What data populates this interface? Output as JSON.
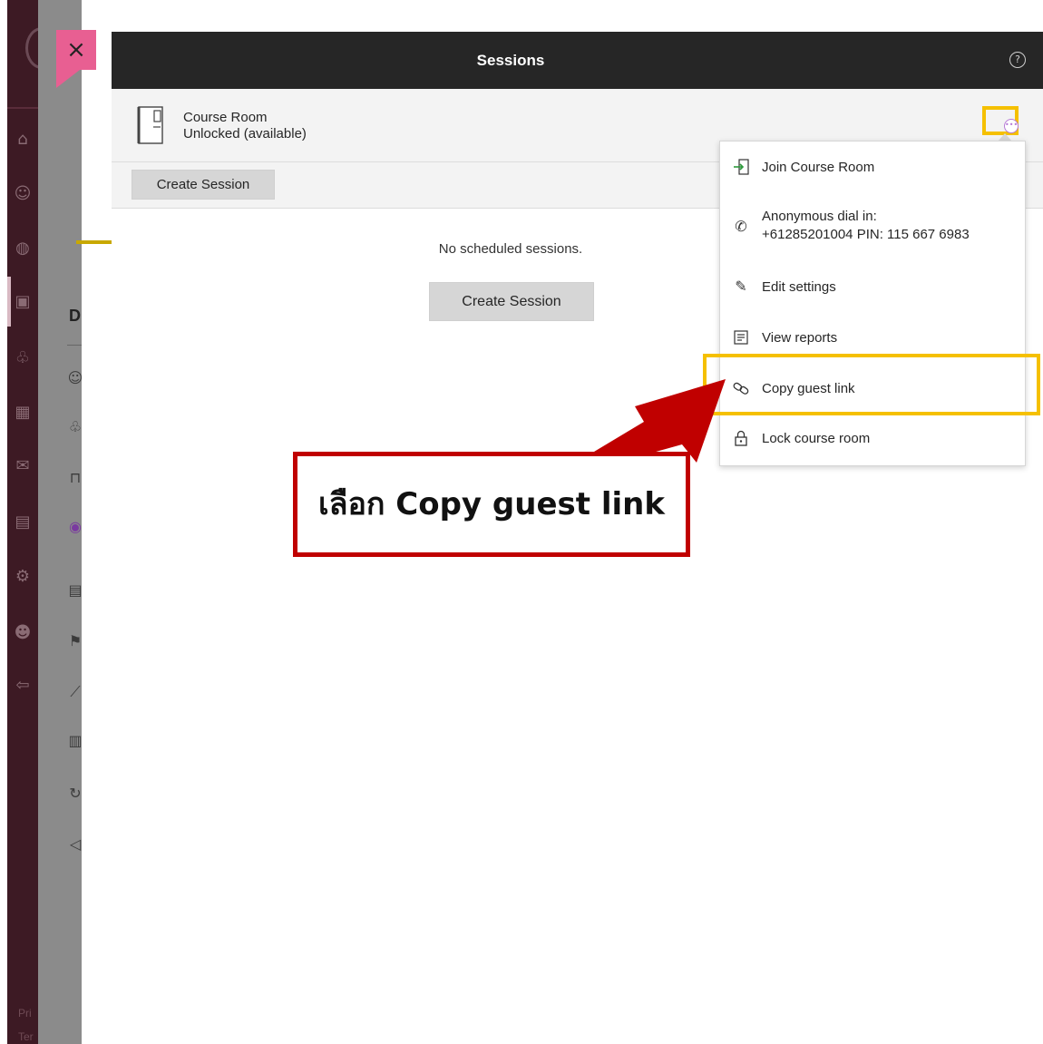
{
  "header": {
    "title": "Sessions",
    "help_icon": "help-circle-icon"
  },
  "close_label": "×",
  "course_room": {
    "name": "Course Room",
    "status": "Unlocked (available)",
    "icon": "door-icon",
    "more_icon": "more-options-icon"
  },
  "toolbar": {
    "create_label": "Create Session"
  },
  "main": {
    "empty_message": "No scheduled sessions.",
    "create_label": "Create Session"
  },
  "menu": {
    "items": [
      {
        "label": "Join Course Room",
        "icon": "enter-icon"
      },
      {
        "label": "Anonymous dial in:",
        "sub": "+61285201004 PIN: 115 667 6983",
        "icon": "phone-icon"
      },
      {
        "label": "Edit settings",
        "icon": "pencil-icon"
      },
      {
        "label": "View reports",
        "icon": "report-icon"
      },
      {
        "label": "Copy guest link",
        "icon": "link-icon"
      },
      {
        "label": "Lock course room",
        "icon": "lock-icon"
      }
    ]
  },
  "annotation": {
    "text": "เลือก Copy guest link",
    "color": "#c00000",
    "highlight_color": "#f5c000"
  },
  "sidebar_footer": {
    "line1": "Pri",
    "line2": "Ter"
  }
}
